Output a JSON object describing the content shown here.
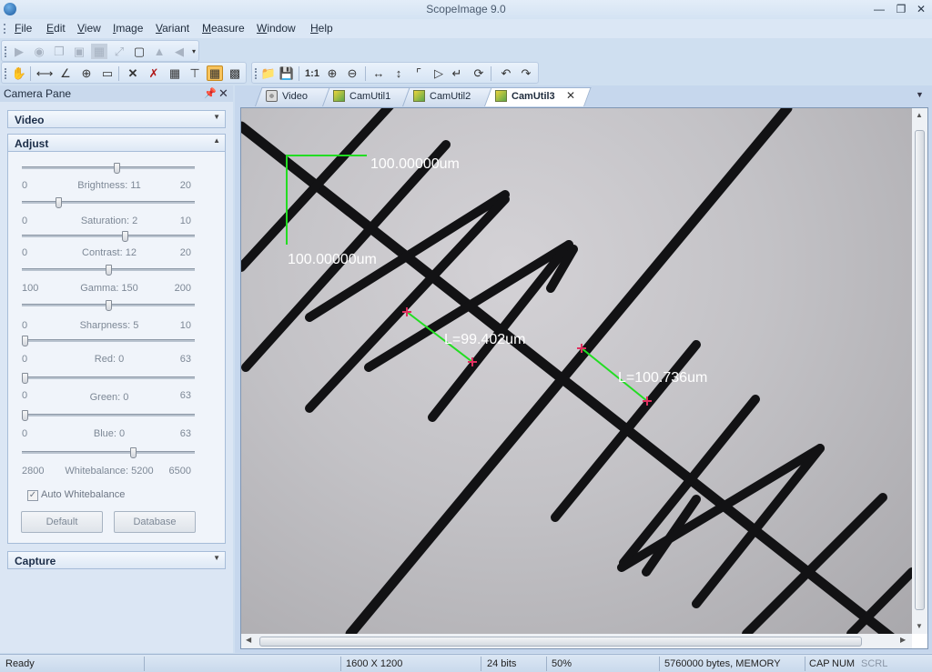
{
  "window": {
    "title": "ScopeImage 9.0"
  },
  "menu": {
    "items": [
      {
        "label": "File",
        "accel": "F",
        "rest": "ile"
      },
      {
        "label": "Edit",
        "accel": "E",
        "rest": "dit"
      },
      {
        "label": "View",
        "accel": "V",
        "rest": "iew"
      },
      {
        "label": "Image",
        "accel": "I",
        "rest": "mage"
      },
      {
        "label": "Variant",
        "accel": "V",
        "rest": "ariant"
      },
      {
        "label": "Measure",
        "accel": "M",
        "rest": "easure"
      },
      {
        "label": "Window",
        "accel": "W",
        "rest": "indow"
      },
      {
        "label": "Help",
        "accel": "H",
        "rest": "elp"
      }
    ]
  },
  "camera_pane": {
    "title": "Camera Pane",
    "sections": {
      "video": "Video",
      "adjust": "Adjust",
      "capture": "Capture"
    },
    "sliders": [
      {
        "label": "Brightness: 11",
        "min": "0",
        "max": "20",
        "level": 0.55
      },
      {
        "label": "Saturation: 2",
        "min": "0",
        "max": "10",
        "level": 0.2
      },
      {
        "label": "Contrast: 12",
        "min": "0",
        "max": "20",
        "level": 0.6
      },
      {
        "label": "Gamma: 150",
        "min": "100",
        "max": "200",
        "level": 0.5
      },
      {
        "label": "Sharpness: 5",
        "min": "0",
        "max": "10",
        "level": 0.5
      },
      {
        "label": "Red: 0",
        "min": "0",
        "max": "63",
        "level": 0.0
      },
      {
        "label": "Green: 0",
        "min": "0",
        "max": "63",
        "level": 0.0
      },
      {
        "label": "Blue: 0",
        "min": "0",
        "max": "63",
        "level": 0.0
      },
      {
        "label": "Whitebalance: 5200",
        "min": "2800",
        "max": "6500",
        "level": 0.65
      }
    ],
    "auto_whitebalance": {
      "label": "Auto Whitebalance",
      "checked": true
    },
    "buttons": {
      "default": "Default",
      "database": "Database"
    }
  },
  "tabs": [
    {
      "label": "Video",
      "icon": "camera-icon"
    },
    {
      "label": "CamUtil1",
      "icon": "image-icon"
    },
    {
      "label": "CamUtil2",
      "icon": "image-icon"
    },
    {
      "label": "CamUtil3",
      "icon": "image-icon",
      "active": true
    }
  ],
  "image": {
    "scale_label_x": "100.00000um",
    "scale_label_y": "100.00000um",
    "measurement_1": "L=99.402um",
    "measurement_2": "L=100.736um",
    "overlay_color": "#22dd22",
    "marker_color": "#e03060"
  },
  "status": {
    "state": "Ready",
    "dimensions": "1600 X 1200",
    "bit_depth": "24 bits",
    "zoom": "50%",
    "memory": "5760000 bytes, MEMORY",
    "caps": "CAP",
    "num": "NUM",
    "scrl": "SCRL"
  }
}
